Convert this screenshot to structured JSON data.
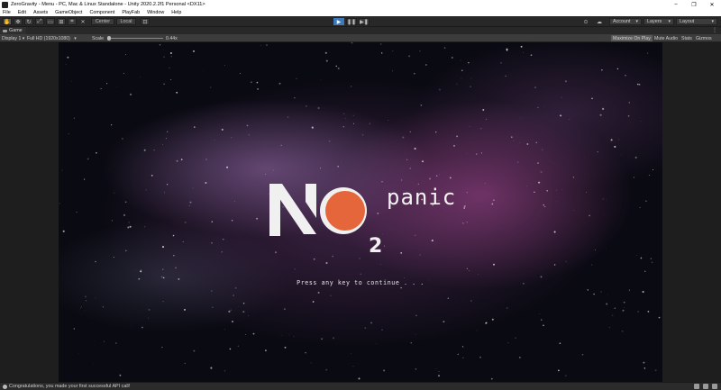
{
  "window": {
    "title": "ZeroGravity - Menu - PC, Mac & Linux Standalone - Unity 2020.2.2f1 Personal <DX11>",
    "controls": [
      "–",
      "❐",
      "✕"
    ]
  },
  "menu": [
    "File",
    "Edit",
    "Assets",
    "GameObject",
    "Component",
    "PlayFab",
    "Window",
    "Help"
  ],
  "toolbar": {
    "pivot_label": "Center",
    "space_label": "Local",
    "account_label": "Account",
    "layers_label": "Layers",
    "layout_label": "Layout",
    "play_color": "#3a79bb"
  },
  "tab": {
    "label": "Game",
    "kebab": "⋮"
  },
  "game_toolbar": {
    "display": "Display 1",
    "resolution": "Full HD (1920x1080)",
    "scale_label": "Scale",
    "scale_value": "0.44x",
    "maximize": "Maximize On Play",
    "mute": "Mute Audio",
    "stats": "Stats",
    "gizmos": "Gizmos"
  },
  "game": {
    "logo_subscript": "2",
    "logo_word": "panic",
    "prompt": "Press any key to continue . . .",
    "orb_color": "#e5663a"
  },
  "status": {
    "message": "Congratulations, you made your first successful API call!"
  }
}
